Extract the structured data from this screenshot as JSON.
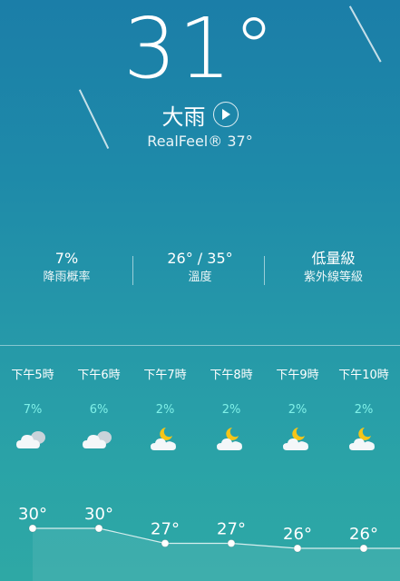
{
  "current": {
    "temperature": "31°",
    "condition": "大雨",
    "realfeel": "RealFeel® 37°"
  },
  "stats": [
    {
      "value": "7%",
      "label": "降雨概率"
    },
    {
      "value": "26° / 35°",
      "label": "溫度"
    },
    {
      "value": "低量級",
      "label": "紫外線等級"
    }
  ],
  "hourly": [
    {
      "time": "下午5時",
      "precip": "7%",
      "icon": "cloudy-icon",
      "temp": "30°"
    },
    {
      "time": "下午6時",
      "precip": "6%",
      "icon": "cloudy-icon",
      "temp": "30°"
    },
    {
      "time": "下午7時",
      "precip": "2%",
      "icon": "partly-cloudy-night-icon",
      "temp": "27°"
    },
    {
      "time": "下午8時",
      "precip": "2%",
      "icon": "partly-cloudy-night-icon",
      "temp": "27°"
    },
    {
      "time": "下午9時",
      "precip": "2%",
      "icon": "partly-cloudy-night-icon",
      "temp": "26°"
    },
    {
      "time": "下午10時",
      "precip": "2%",
      "icon": "partly-cloudy-night-icon",
      "temp": "26°"
    }
  ],
  "colors": {
    "precip_text": "#7ff0e8",
    "moon": "#f5c518"
  }
}
